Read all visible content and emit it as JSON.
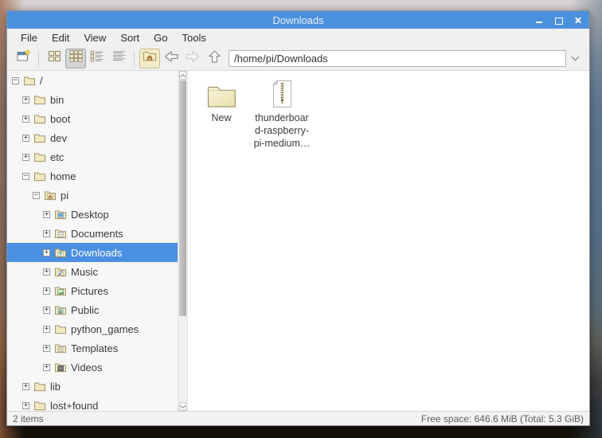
{
  "window": {
    "title": "Downloads"
  },
  "menu": {
    "items": [
      "File",
      "Edit",
      "View",
      "Sort",
      "Go",
      "Tools"
    ]
  },
  "toolbar": {
    "path_value": "/home/pi/Downloads",
    "buttons": [
      "new-window",
      "icon-view",
      "compact-view",
      "detailed-list-view",
      "list-view",
      "home",
      "back",
      "forward",
      "up"
    ],
    "active_view": "compact-view"
  },
  "sidebar": {
    "items": [
      {
        "label": "/",
        "level": 0,
        "expander": "-",
        "icon": "folder"
      },
      {
        "label": "bin",
        "level": 1,
        "expander": "+",
        "icon": "folder"
      },
      {
        "label": "boot",
        "level": 1,
        "expander": "+",
        "icon": "folder"
      },
      {
        "label": "dev",
        "level": 1,
        "expander": "+",
        "icon": "folder"
      },
      {
        "label": "etc",
        "level": 1,
        "expander": "+",
        "icon": "folder"
      },
      {
        "label": "home",
        "level": 1,
        "expander": "-",
        "icon": "folder"
      },
      {
        "label": "pi",
        "level": 2,
        "expander": "-",
        "icon": "home-folder"
      },
      {
        "label": "Desktop",
        "level": 3,
        "expander": "+",
        "icon": "desktop-folder"
      },
      {
        "label": "Documents",
        "level": 3,
        "expander": "+",
        "icon": "documents-folder"
      },
      {
        "label": "Downloads",
        "level": 3,
        "expander": "+",
        "icon": "downloads-folder",
        "selected": true
      },
      {
        "label": "Music",
        "level": 3,
        "expander": "+",
        "icon": "music-folder"
      },
      {
        "label": "Pictures",
        "level": 3,
        "expander": "+",
        "icon": "pictures-folder"
      },
      {
        "label": "Public",
        "level": 3,
        "expander": "+",
        "icon": "public-folder"
      },
      {
        "label": "python_games",
        "level": 3,
        "expander": "+",
        "icon": "folder"
      },
      {
        "label": "Templates",
        "level": 3,
        "expander": "+",
        "icon": "templates-folder"
      },
      {
        "label": "Videos",
        "level": 3,
        "expander": "+",
        "icon": "videos-folder"
      },
      {
        "label": "lib",
        "level": 1,
        "expander": "+",
        "icon": "folder"
      },
      {
        "label": "lost+found",
        "level": 1,
        "expander": "+",
        "icon": "folder"
      }
    ]
  },
  "files": {
    "items": [
      {
        "name": "New",
        "icon": "folder"
      },
      {
        "name": "thunderboar\nd-raspberry-\npi-medium…",
        "icon": "zip-file"
      }
    ]
  },
  "statusbar": {
    "left": "2 items",
    "right": "Free space: 646.6 MiB (Total: 5.3 GiB)"
  },
  "colors": {
    "titlebar": "#4b90dc",
    "selection": "#4a8fe2",
    "folder": "#f2e9c2"
  }
}
